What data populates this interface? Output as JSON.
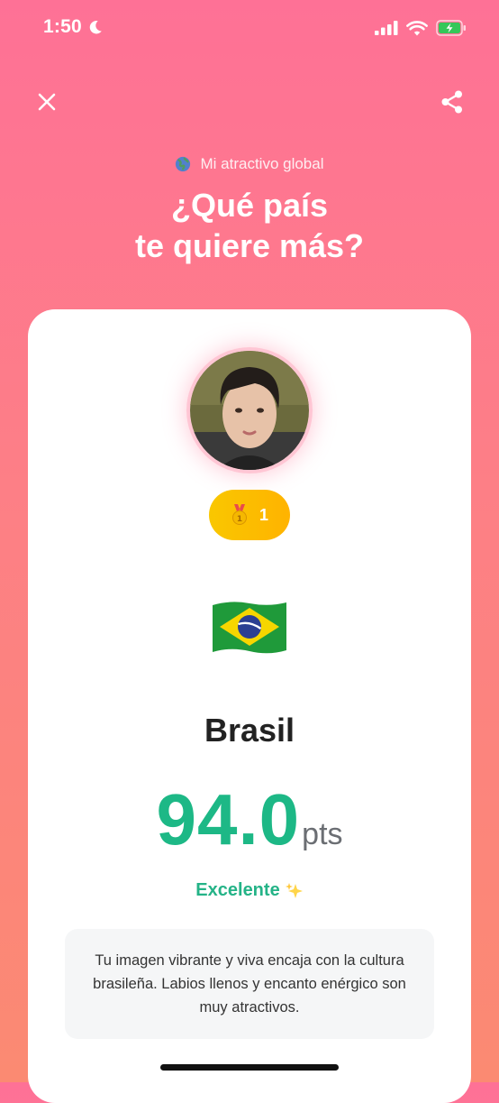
{
  "status_bar": {
    "time": "1:50"
  },
  "header": {
    "subtitle": "Mi atractivo global",
    "title_line1": "¿Qué país",
    "title_line2": "te quiere más?"
  },
  "card": {
    "rank": "1",
    "country": "Brasil",
    "score": "94.0",
    "score_unit": "pts",
    "rating": "Excelente",
    "description": "Tu imagen vibrante y viva encaja con la cultura brasileña. Labios llenos y encanto enérgico son muy atractivos."
  },
  "colors": {
    "background_top": "#fe7196",
    "background_bottom": "#fb8a72",
    "score_green": "#1db886",
    "badge_gold": "#f9c700"
  },
  "icons": [
    "moon-icon",
    "signal-icon",
    "wifi-icon",
    "battery-charging-icon",
    "close-icon",
    "share-icon",
    "globe-icon",
    "medal-icon",
    "brazil-flag",
    "sparkles-icon"
  ]
}
